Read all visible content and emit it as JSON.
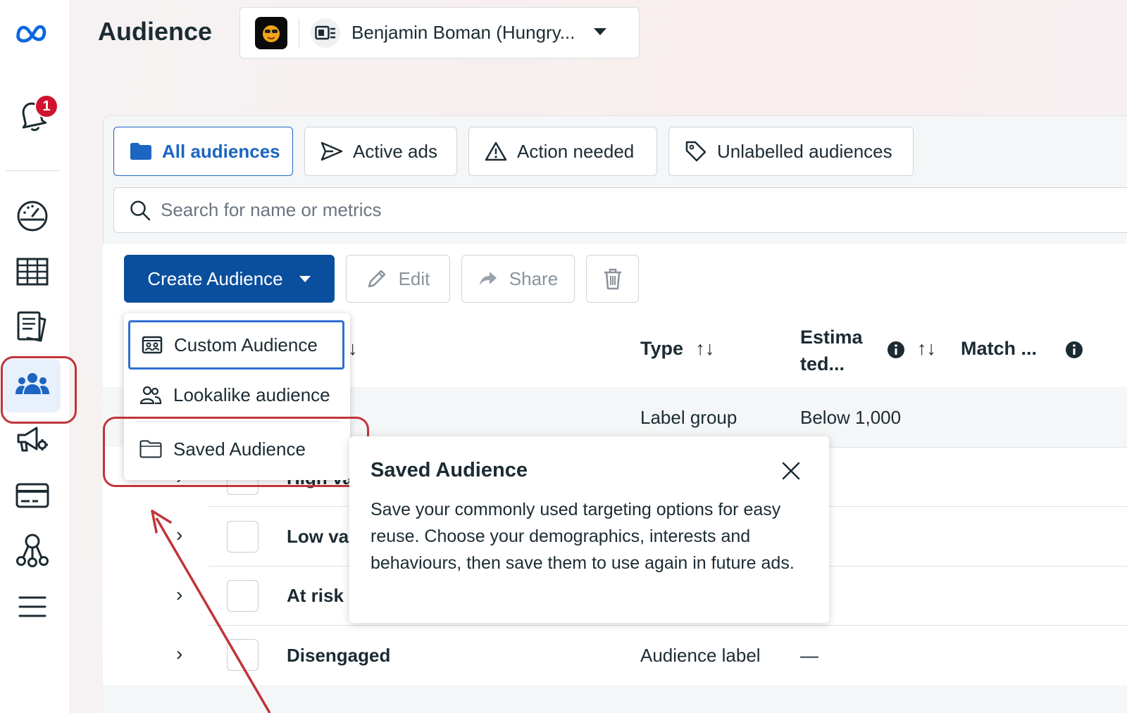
{
  "header": {
    "title": "Audience",
    "account_name": "Benjamin Boman (Hungry..."
  },
  "sidebar": {
    "notification_count": "1",
    "items": [
      {
        "icon": "meta-logo-icon"
      },
      {
        "icon": "bell-icon"
      },
      {
        "icon": "dashboard-gauge-icon"
      },
      {
        "icon": "table-grid-icon"
      },
      {
        "icon": "pages-icon"
      },
      {
        "icon": "audience-people-icon",
        "active": true
      },
      {
        "icon": "megaphone-settings-icon"
      },
      {
        "icon": "billing-card-icon"
      },
      {
        "icon": "business-network-icon"
      },
      {
        "icon": "menu-icon"
      }
    ]
  },
  "tabs": [
    {
      "label": "All audiences",
      "icon": "folder-icon",
      "active": true
    },
    {
      "label": "Active ads",
      "icon": "send-icon"
    },
    {
      "label": "Action needed",
      "icon": "warning-icon"
    },
    {
      "label": "Unlabelled audiences",
      "icon": "tag-icon"
    }
  ],
  "search": {
    "placeholder": "Search for name or metrics"
  },
  "toolbar": {
    "create_label": "Create Audience",
    "edit_label": "Edit",
    "share_label": "Share"
  },
  "dropdown": {
    "items": [
      {
        "label": "Custom Audience",
        "icon": "custom-audience-icon"
      },
      {
        "label": "Lookalike audience",
        "icon": "lookalike-icon"
      },
      {
        "label": "Saved Audience",
        "icon": "folder-outline-icon"
      }
    ]
  },
  "table": {
    "columns": {
      "sort_arrow": "↓",
      "type": "Type",
      "estimated_line1": "Estima",
      "estimated_line2": "ted...",
      "match": "Match ..."
    },
    "rows": [
      {
        "name": "",
        "type": "Label group",
        "estimated": "Below 1,000"
      },
      {
        "name": "High va",
        "type": "",
        "estimated": ""
      },
      {
        "name": "Low val",
        "type": "",
        "estimated": ""
      },
      {
        "name": "At risk",
        "type": "",
        "estimated": ""
      },
      {
        "name": "Disengaged",
        "type": "Audience label",
        "estimated": "—"
      }
    ]
  },
  "popover": {
    "title": "Saved Audience",
    "body": "Save your commonly used targeting options for easy reuse. Choose your demographics, interests and behaviours, then save them to use again in future ads."
  },
  "colors": {
    "primary": "#0a4f9e",
    "accent": "#1d65c1",
    "highlight_annotation": "#c0343a",
    "badge": "#d0132f"
  }
}
